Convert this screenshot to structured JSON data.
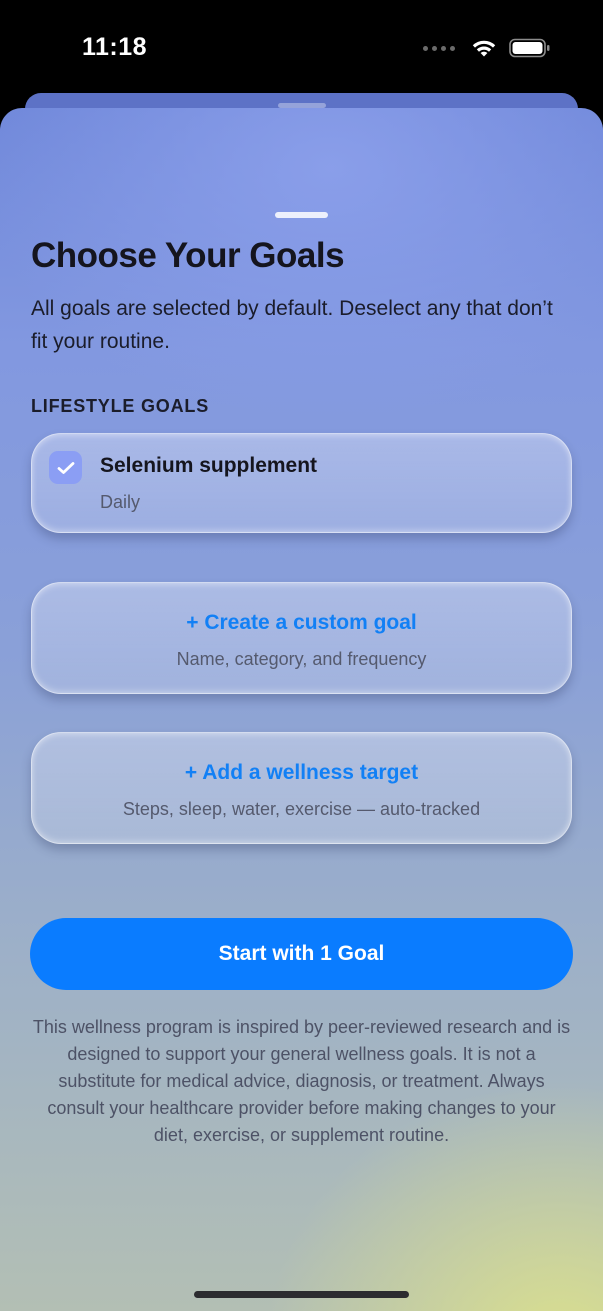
{
  "status_bar": {
    "time": "11:18",
    "icons": [
      "signal-dots-icon",
      "wifi-icon",
      "battery-icon"
    ]
  },
  "sheet": {
    "title": "Choose Your Goals",
    "subtitle": "All goals are selected by default. Deselect any that don’t fit your routine.",
    "section_label": "LIFESTYLE GOALS",
    "goals": [
      {
        "name": "Selenium supplement",
        "frequency": "Daily",
        "selected": true
      }
    ],
    "actions": {
      "custom_goal": {
        "title": "+ Create a custom goal",
        "subtitle": "Name, category, and frequency"
      },
      "wellness_target": {
        "title": "+ Add a wellness target",
        "subtitle": "Steps, sleep, water, exercise — auto-tracked"
      }
    },
    "start_button_label": "Start with 1 Goal",
    "disclaimer": "This wellness program is inspired by peer-reviewed research and is designed to support your general wellness goals. It is not a substitute for medical advice, diagnosis, or treatment. Always consult your healthcare provider before making changes to your diet, exercise, or supplement routine."
  },
  "colors": {
    "accent": "#0a7cff",
    "checkbox": "#8b9ef4",
    "link_text": "#1280f5"
  }
}
